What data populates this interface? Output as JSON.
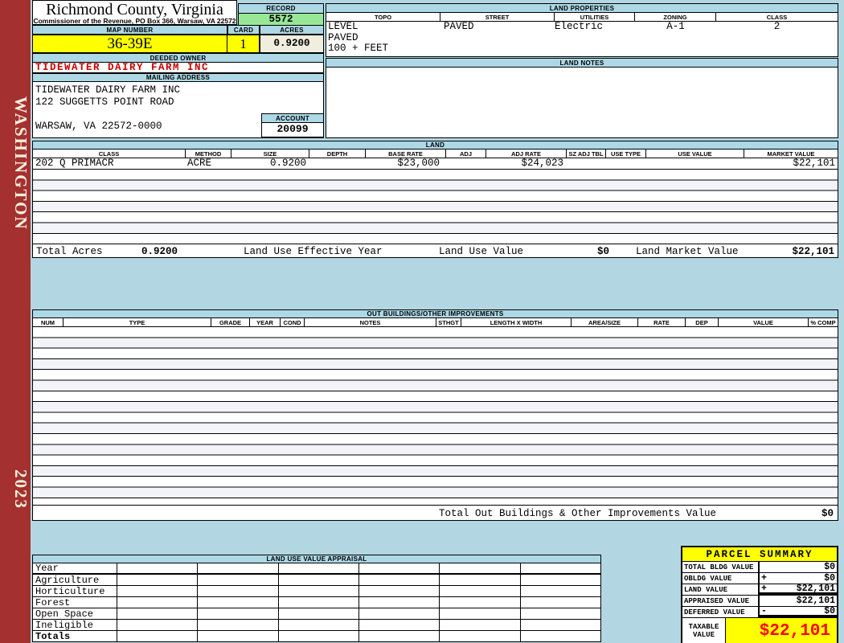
{
  "sidebar": {
    "county": "WASHINGTON",
    "year": "2023"
  },
  "header": {
    "title": "Richmond County, Virginia",
    "subtitle": "Commissioner of the Revenue, PO Box 366, Warsaw, VA 22572",
    "record_label": "RECORD",
    "record_value": "5572",
    "map_number_label": "MAP NUMBER",
    "map_number_value": "36-39E",
    "card_label": "CARD",
    "card_value": "1",
    "acres_label": "ACRES",
    "acres_value": "0.9200",
    "deeded_owner_label": "DEEDED OWNER",
    "deeded_owner": "TIDEWATER DAIRY FARM INC",
    "mailing_address_label": "MAILING ADDRESS",
    "mailing_address_lines": [
      "TIDEWATER DAIRY FARM INC",
      "122 SUGGETTS POINT ROAD",
      "",
      "WARSAW, VA 22572-0000"
    ],
    "account_label": "ACCOUNT",
    "account_value": "20099"
  },
  "land_properties": {
    "title": "LAND PROPERTIES",
    "columns": [
      "TOPO",
      "STREET",
      "UTILITIES",
      "ZONING",
      "CLASS"
    ],
    "topo_lines": [
      "LEVEL",
      "PAVED",
      "100 + FEET"
    ],
    "street": "PAVED",
    "utilities": "Electric",
    "zoning": "A-1",
    "class": "2"
  },
  "land_notes": {
    "title": "LAND NOTES"
  },
  "land": {
    "title": "LAND",
    "columns": [
      "CLASS",
      "METHOD",
      "SIZE",
      "DEPTH",
      "BASE RATE",
      "ADJ",
      "ADJ RATE",
      "SZ ADJ TBL",
      "USE TYPE",
      "USE VALUE",
      "MARKET VALUE"
    ],
    "rows": [
      {
        "class": "202 Q PRIMACR",
        "method": "ACRE",
        "size": "0.9200",
        "depth": "",
        "base_rate": "$23,000",
        "adj": "",
        "adj_rate": "$24,023",
        "sz_adj_tbl": "",
        "use_type": "",
        "use_value": "",
        "market_value": "$22,101"
      }
    ],
    "totals": {
      "total_acres_label": "Total Acres",
      "total_acres": "0.9200",
      "effective_year_label": "Land Use Effective Year",
      "use_value_label": "Land Use Value",
      "use_value": "$0",
      "market_value_label": "Land Market Value",
      "market_value": "$22,101"
    }
  },
  "out_buildings": {
    "title": "OUT BUILDINGS/OTHER IMPROVEMENTS",
    "columns": [
      "NUM",
      "TYPE",
      "GRADE",
      "YEAR",
      "COND",
      "NOTES",
      "STHGT",
      "LENGTH X WIDTH",
      "AREA/SIZE",
      "RATE",
      "DEP",
      "VALUE",
      "% COMP"
    ],
    "total_label": "Total Out Buildings & Other Improvements Value",
    "total_value": "$0"
  },
  "land_use_appraisal": {
    "title": "LAND USE VALUE APPRAISAL",
    "rows": [
      "Year",
      "Agriculture",
      "Horticulture",
      "Forest",
      "Open Space",
      "Ineligible",
      "Totals"
    ]
  },
  "parcel_summary": {
    "title": "PARCEL SUMMARY",
    "rows": [
      {
        "label": "TOTAL BLDG VALUE",
        "op": "",
        "value": "$0"
      },
      {
        "label": "OBLDG VALUE",
        "op": "+",
        "value": "$0"
      },
      {
        "label": "LAND VALUE",
        "op": "+",
        "value": "$22,101"
      },
      {
        "label": "APPRAISED VALUE",
        "op": "",
        "value": "$22,101"
      },
      {
        "label": "DEFERRED VALUE",
        "op": "-",
        "value": "$0"
      }
    ],
    "taxable_label_line1": "TAXABLE",
    "taxable_label_line2": "VALUE",
    "taxable_value": "$22,101"
  },
  "colors": {
    "section_bar_blue": "#ADD8E6",
    "highlight_yellow": "#FFFF00",
    "record_green": "#97E797",
    "acres_ivory": "#EFEEDF",
    "sidebar_red": "#A43030",
    "owner_red": "#CC0000",
    "taxable_red": "#FF0000",
    "page_bg": "#B3D7E2"
  }
}
